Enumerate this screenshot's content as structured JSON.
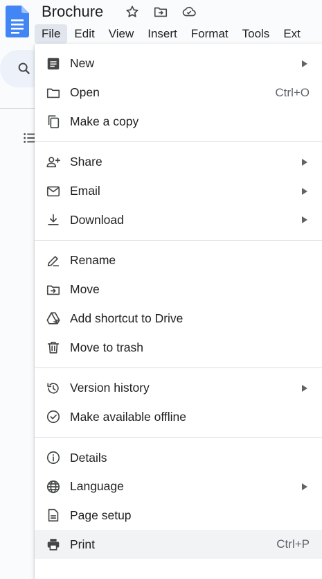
{
  "doc": {
    "title": "Brochure"
  },
  "menubar": [
    {
      "label": "File",
      "name": "menubar-file",
      "active": true
    },
    {
      "label": "Edit",
      "name": "menubar-edit"
    },
    {
      "label": "View",
      "name": "menubar-view"
    },
    {
      "label": "Insert",
      "name": "menubar-insert"
    },
    {
      "label": "Format",
      "name": "menubar-format"
    },
    {
      "label": "Tools",
      "name": "menubar-tools"
    },
    {
      "label": "Ext",
      "name": "menubar-extensions"
    }
  ],
  "file_menu": {
    "groups": [
      [
        {
          "label": "New",
          "icon": "new-document-icon",
          "submenu": true
        },
        {
          "label": "Open",
          "icon": "folder-open-icon",
          "shortcut": "Ctrl+O"
        },
        {
          "label": "Make a copy",
          "icon": "copy-icon"
        }
      ],
      [
        {
          "label": "Share",
          "icon": "person-add-icon",
          "submenu": true
        },
        {
          "label": "Email",
          "icon": "email-icon",
          "submenu": true
        },
        {
          "label": "Download",
          "icon": "download-icon",
          "submenu": true
        }
      ],
      [
        {
          "label": "Rename",
          "icon": "rename-pencil-icon"
        },
        {
          "label": "Move",
          "icon": "move-folder-icon"
        },
        {
          "label": "Add shortcut to Drive",
          "icon": "drive-shortcut-icon"
        },
        {
          "label": "Move to trash",
          "icon": "trash-icon"
        }
      ],
      [
        {
          "label": "Version history",
          "icon": "history-icon",
          "submenu": true
        },
        {
          "label": "Make available offline",
          "icon": "offline-check-icon"
        }
      ],
      [
        {
          "label": "Details",
          "icon": "info-icon"
        },
        {
          "label": "Language",
          "icon": "globe-icon",
          "submenu": true
        },
        {
          "label": "Page setup",
          "icon": "page-setup-icon"
        },
        {
          "label": "Print",
          "icon": "printer-icon",
          "shortcut": "Ctrl+P",
          "hover": true
        }
      ]
    ]
  },
  "colors": {
    "docs_blue": "#4285f4",
    "icon_gray": "#444746",
    "background": "#f9fbfd"
  }
}
